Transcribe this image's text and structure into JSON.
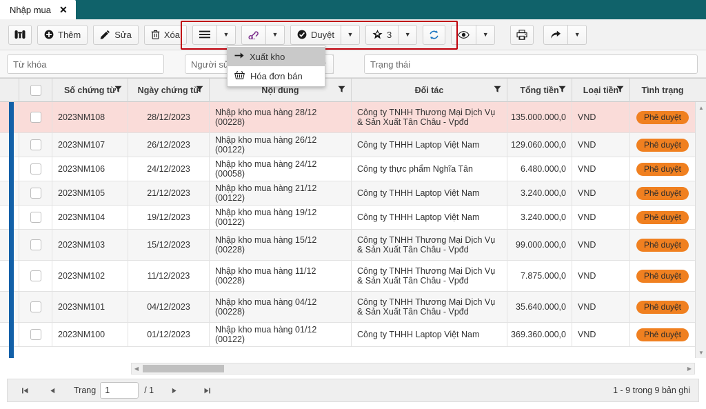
{
  "tab": {
    "label": "Nhập mua",
    "close_icon": "close-icon"
  },
  "toolbar": {
    "search_icon": "binoculars-icon",
    "add_label": "Thêm",
    "edit_label": "Sửa",
    "delete_label": "Xóa",
    "menu_icon": "hamburger-icon",
    "link_icon": "link-icon",
    "approve_label": "Duyệt",
    "favorite_count": "3",
    "refresh_icon": "refresh-icon",
    "view_icon": "eye-icon",
    "print_icon": "printer-icon",
    "share_icon": "share-arrow-icon",
    "caret": "▼",
    "highlight_color": "#c0000b"
  },
  "dropdown": {
    "items": [
      {
        "label": "Xuất kho",
        "icon": "arrow-right-icon",
        "active": true
      },
      {
        "label": "Hóa đơn bán",
        "icon": "basket-icon",
        "active": false
      }
    ]
  },
  "filters": {
    "keyword_placeholder": "Từ khóa",
    "keyword_value": "",
    "user_placeholder": "Người sử dụng",
    "user_value": "",
    "status_placeholder": "Trạng thái",
    "status_value": ""
  },
  "grid": {
    "columns": [
      {
        "label": "",
        "key": "handle",
        "filter": false,
        "align": "center"
      },
      {
        "label": "",
        "key": "check",
        "filter": false,
        "align": "center"
      },
      {
        "label": "Số chứng từ",
        "key": "so_chung_tu",
        "filter": true,
        "align": "center"
      },
      {
        "label": "Ngày chứng từ",
        "key": "ngay_chung_tu",
        "filter": true,
        "align": "center"
      },
      {
        "label": "Nội dung",
        "key": "noi_dung",
        "filter": true,
        "align": "left"
      },
      {
        "label": "Đối tác",
        "key": "doi_tac",
        "filter": true,
        "align": "left"
      },
      {
        "label": "Tổng tiền",
        "key": "tong_tien",
        "filter": true,
        "align": "right"
      },
      {
        "label": "Loại tiền",
        "key": "loai_tien",
        "filter": true,
        "align": "left"
      },
      {
        "label": "Tình trạng",
        "key": "tinh_trang",
        "filter": false,
        "align": "center"
      }
    ],
    "rows": [
      {
        "so_chung_tu": "2023NM108",
        "ngay_chung_tu": "28/12/2023",
        "noi_dung": "Nhập kho mua hàng 28/12 (00228)",
        "doi_tac": "Công ty TNHH Thương Mại Dịch Vụ & Sản Xuất Tân Châu - Vpđd",
        "tong_tien": "135.000.000,0",
        "loai_tien": "VND",
        "tinh_trang": "Phê duyệt",
        "selected": true
      },
      {
        "so_chung_tu": "2023NM107",
        "ngay_chung_tu": "26/12/2023",
        "noi_dung": "Nhập kho mua hàng 26/12 (00122)",
        "doi_tac": "Công ty THHH Laptop Việt Nam",
        "tong_tien": "129.060.000,0",
        "loai_tien": "VND",
        "tinh_trang": "Phê duyệt",
        "selected": false
      },
      {
        "so_chung_tu": "2023NM106",
        "ngay_chung_tu": "24/12/2023",
        "noi_dung": "Nhập kho mua hàng 24/12 (00058)",
        "doi_tac": "Công ty thực phẩm Nghĩa Tân",
        "tong_tien": "6.480.000,0",
        "loai_tien": "VND",
        "tinh_trang": "Phê duyệt",
        "selected": false
      },
      {
        "so_chung_tu": "2023NM105",
        "ngay_chung_tu": "21/12/2023",
        "noi_dung": "Nhập kho mua hàng 21/12 (00122)",
        "doi_tac": "Công ty THHH Laptop Việt Nam",
        "tong_tien": "3.240.000,0",
        "loai_tien": "VND",
        "tinh_trang": "Phê duyệt",
        "selected": false
      },
      {
        "so_chung_tu": "2023NM104",
        "ngay_chung_tu": "19/12/2023",
        "noi_dung": "Nhập kho mua hàng 19/12 (00122)",
        "doi_tac": "Công ty THHH Laptop Việt Nam",
        "tong_tien": "3.240.000,0",
        "loai_tien": "VND",
        "tinh_trang": "Phê duyệt",
        "selected": false
      },
      {
        "so_chung_tu": "2023NM103",
        "ngay_chung_tu": "15/12/2023",
        "noi_dung": "Nhập kho mua hàng 15/12 (00228)",
        "doi_tac": "Công ty TNHH Thương Mại Dịch Vụ & Sản Xuất Tân Châu - Vpđd",
        "tong_tien": "99.000.000,0",
        "loai_tien": "VND",
        "tinh_trang": "Phê duyệt",
        "selected": false
      },
      {
        "so_chung_tu": "2023NM102",
        "ngay_chung_tu": "11/12/2023",
        "noi_dung": "Nhập kho mua hàng 11/12 (00228)",
        "doi_tac": "Công ty TNHH Thương Mại Dịch Vụ & Sản Xuất Tân Châu - Vpđd",
        "tong_tien": "7.875.000,0",
        "loai_tien": "VND",
        "tinh_trang": "Phê duyệt",
        "selected": false
      },
      {
        "so_chung_tu": "2023NM101",
        "ngay_chung_tu": "04/12/2023",
        "noi_dung": "Nhập kho mua hàng 04/12 (00228)",
        "doi_tac": "Công ty TNHH Thương Mại Dịch Vụ & Sản Xuất Tân Châu - Vpđd",
        "tong_tien": "35.640.000,0",
        "loai_tien": "VND",
        "tinh_trang": "Phê duyệt",
        "selected": false
      },
      {
        "so_chung_tu": "2023NM100",
        "ngay_chung_tu": "01/12/2023",
        "noi_dung": "Nhập kho mua hàng 01/12 (00122)",
        "doi_tac": "Công ty THHH Laptop Việt Nam",
        "tong_tien": "369.360.000,0",
        "loai_tien": "VND",
        "tinh_trang": "Phê duyệt",
        "selected": false
      }
    ]
  },
  "pager": {
    "first_icon": "first-page-icon",
    "prev_icon": "prev-page-icon",
    "page_label": "Trang",
    "page_value": "1",
    "total_pages": "/ 1",
    "next_icon": "next-page-icon",
    "last_icon": "last-page-icon",
    "record_count": "1 - 9 trong 9 bản ghi"
  },
  "colors": {
    "header_teal": "#10626a",
    "selected_row": "#fadcd9",
    "badge_orange": "#f08020",
    "left_accent": "#1260a8",
    "highlight_red": "#c0000b"
  }
}
